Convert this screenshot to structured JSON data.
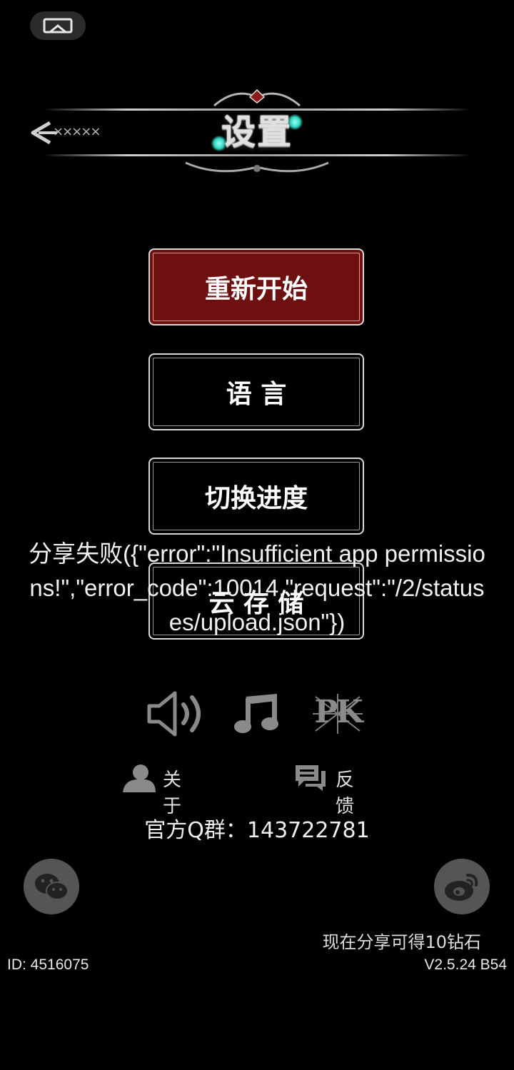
{
  "header": {
    "title": "设置",
    "back_label": "×××××"
  },
  "menu": {
    "restart": "重新开始",
    "language": "语 言",
    "switch_progress": "切换进度",
    "cloud_save": "云 存 储"
  },
  "toast": {
    "message": "分享失败({\"error\":\"Insufficient app permissions!\",\"error_code\":10014,\"request\":\"/2/statuses/upload.json\"})"
  },
  "toggles": {
    "pk_label": "PK"
  },
  "links": {
    "about": "关 于",
    "feedback": "反 馈"
  },
  "qq_group": "官方Q群：143722781",
  "share": {
    "tip": "现在分享可得10钻石"
  },
  "footer": {
    "id": "ID: 4516075",
    "version": "V2.5.24 B54"
  },
  "colors": {
    "background": "#000000",
    "restart_button": "#6e0f10",
    "icon_gray": "#8a8a8a",
    "circle_gray": "#555555"
  }
}
